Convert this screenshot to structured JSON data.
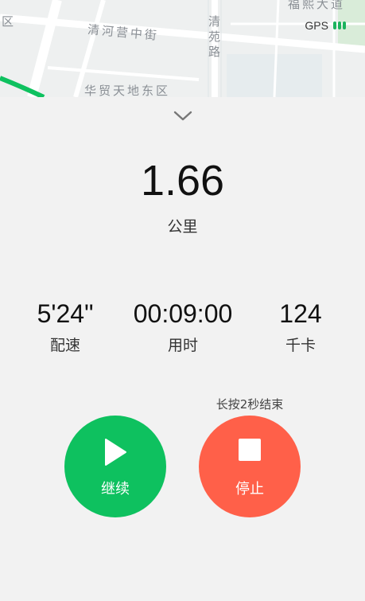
{
  "map": {
    "labels": {
      "street_qinghe": "清河营中街",
      "road_qingyuan": "清苑路",
      "district_huamao": "华贸天地东区",
      "avenue_top": "福熙大道",
      "edge_left": "区"
    },
    "gps_label": "GPS",
    "gps_color": "#1bb35d",
    "route_color": "#0ec15f"
  },
  "workout": {
    "distance_value": "1.66",
    "distance_unit": "公里",
    "stats": [
      {
        "value": "5'24\"",
        "label": "配速"
      },
      {
        "value": "00:09:00",
        "label": "用时"
      },
      {
        "value": "124",
        "label": "千卡"
      }
    ]
  },
  "controls": {
    "stop_hint": "长按2秒结束",
    "resume_label": "继续",
    "stop_label": "停止",
    "resume_color": "#0ec15f",
    "stop_color": "#ff6049"
  },
  "icons": {
    "collapse": "chevron-down-icon",
    "resume": "play-icon",
    "stop": "stop-square-icon"
  }
}
